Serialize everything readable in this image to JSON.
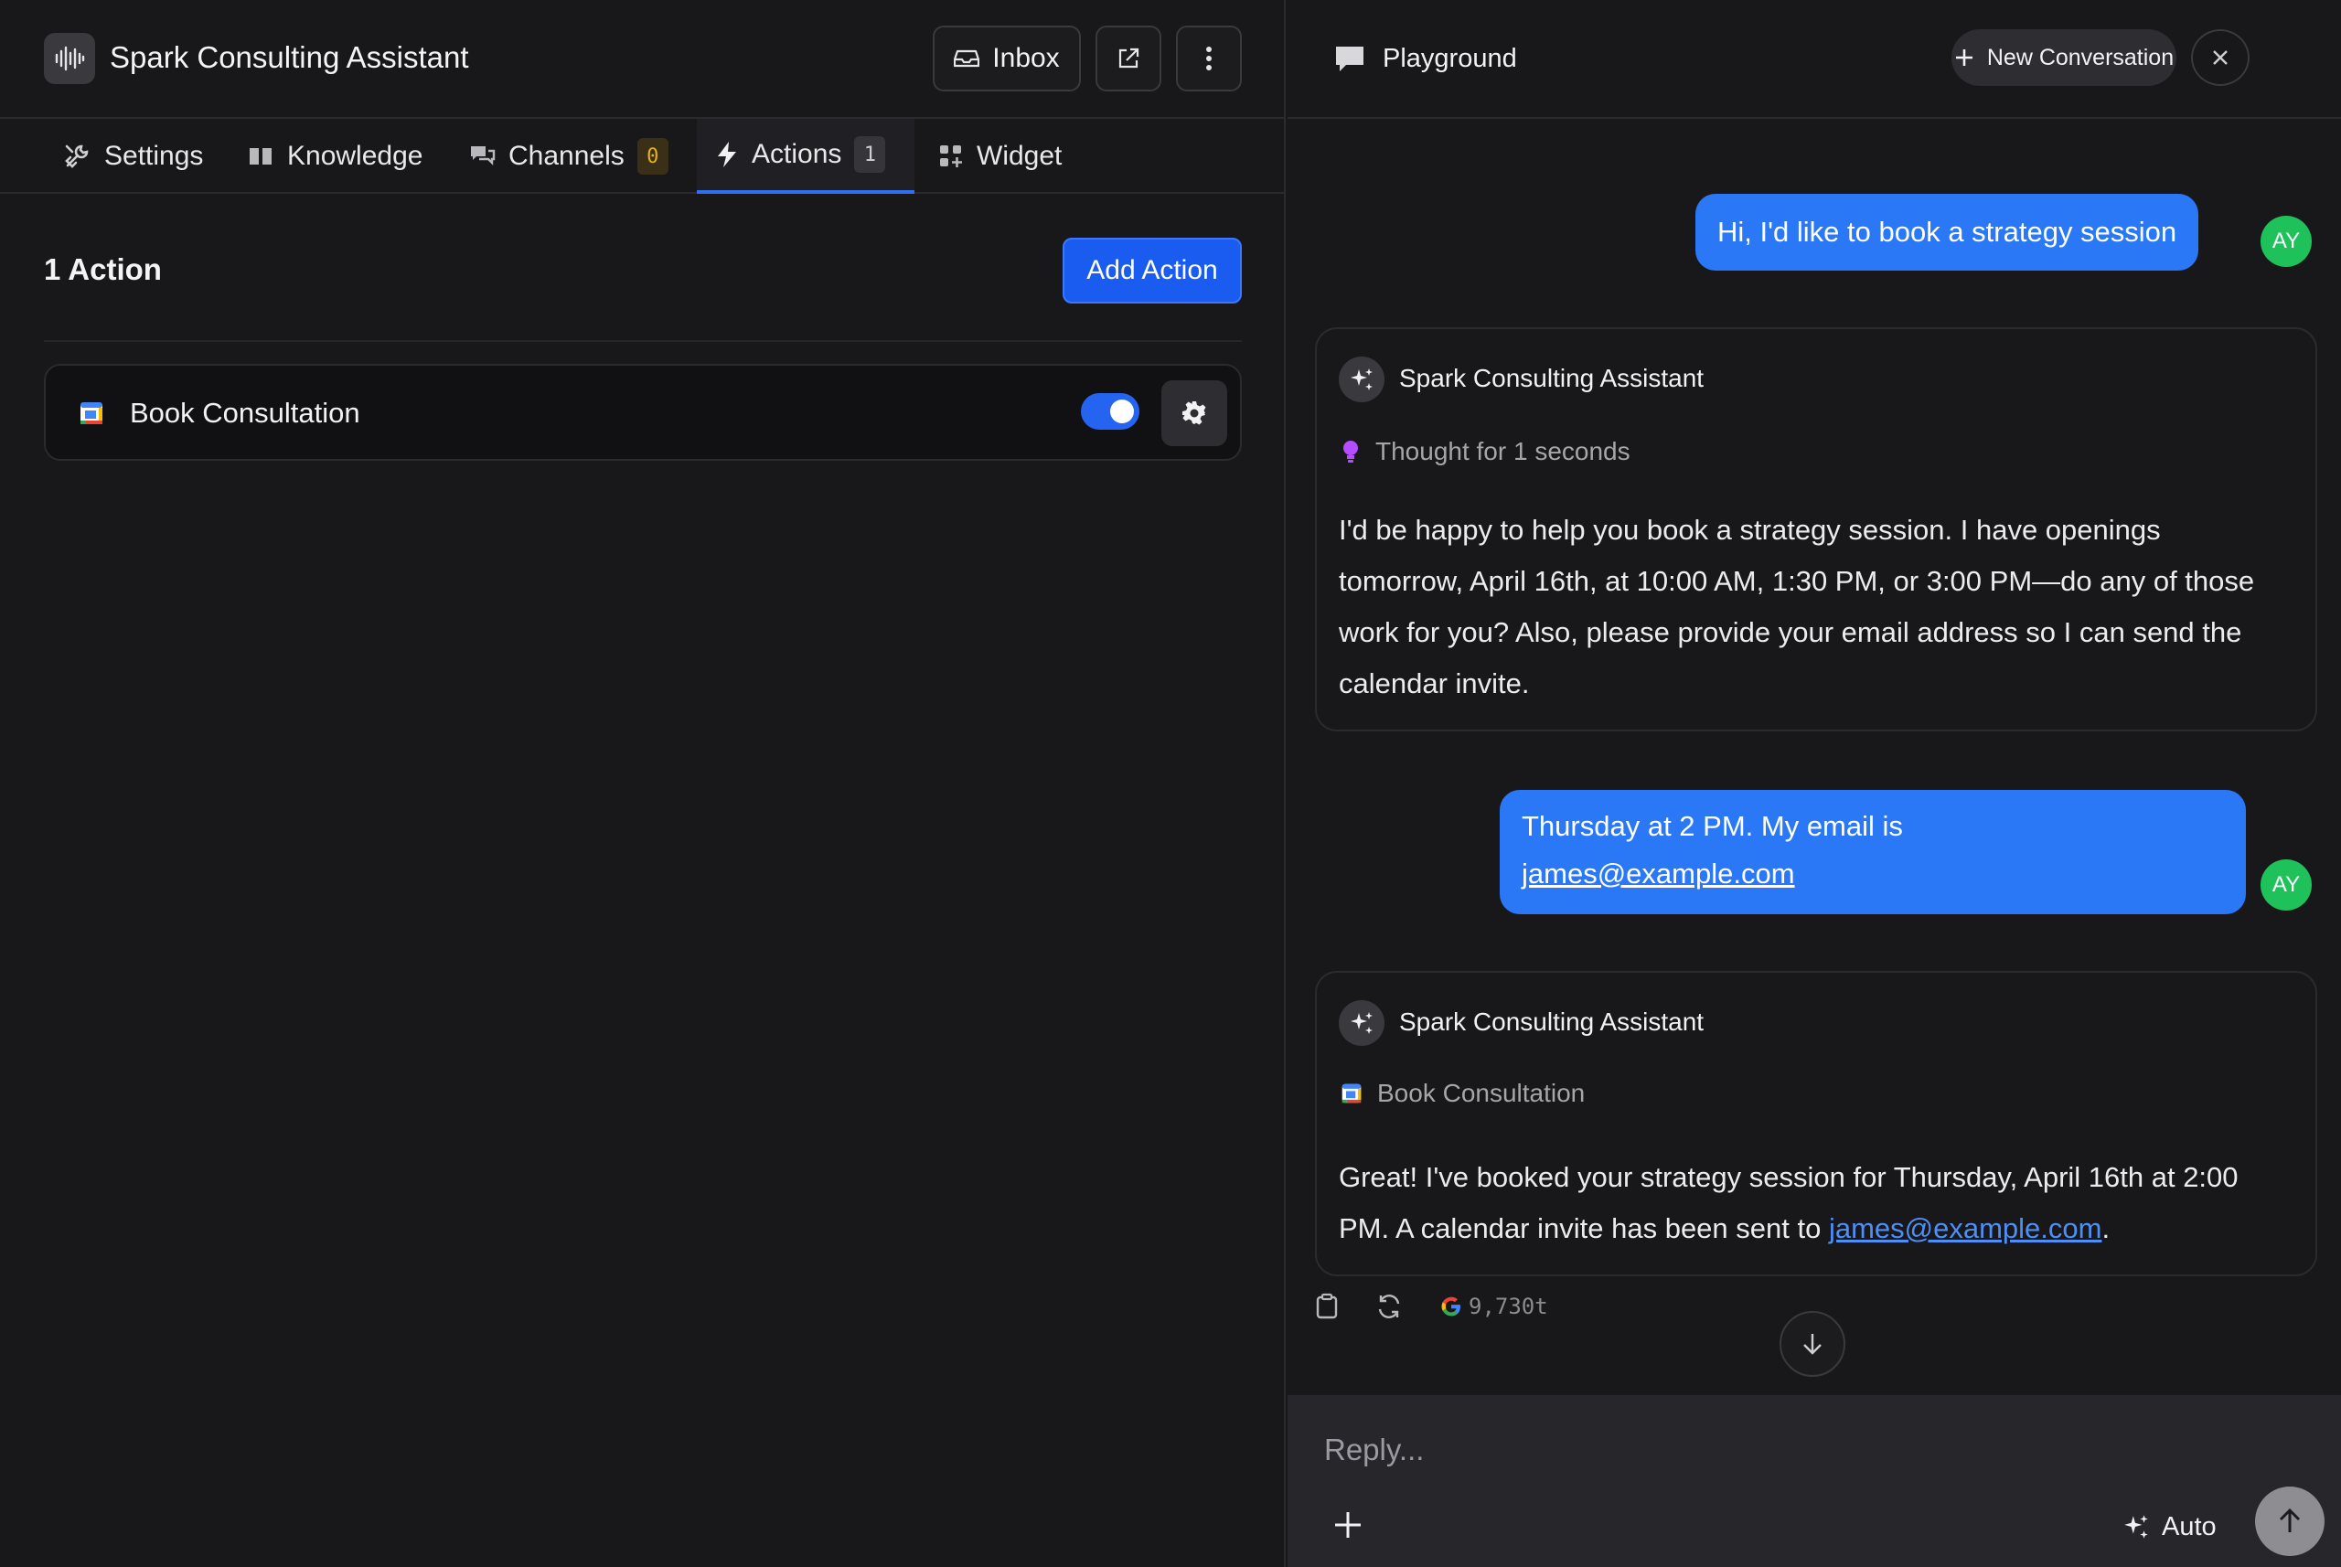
{
  "app": {
    "title": "Spark Consulting Assistant"
  },
  "toolbar": {
    "inbox_label": "Inbox"
  },
  "tabs": [
    {
      "label": "Settings",
      "icon": "wrench-icon"
    },
    {
      "label": "Knowledge",
      "icon": "book-icon"
    },
    {
      "label": "Channels",
      "icon": "chat-icon",
      "count": "0"
    },
    {
      "label": "Actions",
      "icon": "bolt-icon",
      "count": "1",
      "active": true
    },
    {
      "label": "Widget",
      "icon": "grid-icon"
    }
  ],
  "actions_section": {
    "title": "1 Action",
    "add_button": "Add Action",
    "items": [
      {
        "name": "Book Consultation",
        "enabled": true
      }
    ]
  },
  "playground": {
    "title": "Playground",
    "new_conversation": "New Conversation",
    "messages": [
      {
        "role": "user",
        "avatar": "AY",
        "text": "Hi, I'd like to book a strategy session"
      },
      {
        "role": "assistant",
        "name": "Spark Consulting Assistant",
        "meta": "Thought for 1 seconds",
        "text": "I'd be happy to help you book a strategy session. I have openings tomorrow, April 16th, at 10:00 AM, 1:30 PM, or 3:00 PM—do any of those work for you? Also, please provide your email address so I can send the calendar invite."
      },
      {
        "role": "user",
        "avatar": "AY",
        "text_line1": "Thursday at 2 PM. My email is",
        "email": "james@example.com"
      },
      {
        "role": "assistant",
        "name": "Spark Consulting Assistant",
        "meta": "Book Consultation",
        "text_before": "Great! I've booked your strategy session for Thursday, April 16th at 2:00 PM. A calendar invite has been sent to ",
        "email": "james@example.com",
        "text_after": "."
      }
    ],
    "tokens": "9,730t",
    "composer": {
      "placeholder": "Reply...",
      "mode": "Auto"
    }
  },
  "colors": {
    "accent": "#1a5cf0",
    "user_bubble": "#2a78f5",
    "avatar": "#1ec15a",
    "background": "#18181a"
  }
}
